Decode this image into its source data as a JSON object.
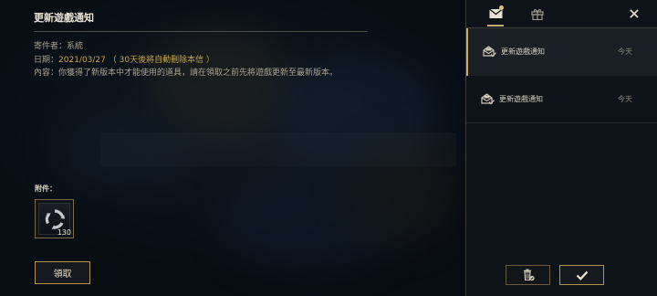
{
  "mail": {
    "title": "更新遊戲通知",
    "sender": "寄件者：系統",
    "date_label": "日期：",
    "date_value": "2021/03/27 （ 30天後將自動刪除本信 ）",
    "body": "內容：你獲得了新版本中才能使用的道具，請在領取之前先將遊戲更新至最新版本。",
    "attachments_label": "附件：",
    "attachment": {
      "icon": "refresh-token-icon",
      "quantity": "130"
    },
    "claim_label": "領取"
  },
  "panel": {
    "tabs": [
      {
        "name": "mail",
        "icon": "envelope-icon",
        "has_notification": true
      },
      {
        "name": "gift",
        "icon": "gift-icon"
      }
    ],
    "close_icon": "close-icon",
    "mails": [
      {
        "title": "更新遊戲通知",
        "date": "今天",
        "selected": true
      },
      {
        "title": "更新遊戲通知",
        "date": "今天",
        "selected": false
      }
    ],
    "delete_icon": "trash-icon",
    "confirm_icon": "check-icon"
  },
  "colors": {
    "accent_gold": "#c8aa6e",
    "date_gold": "#c9a44e",
    "panel_bg": "#0e1319"
  }
}
